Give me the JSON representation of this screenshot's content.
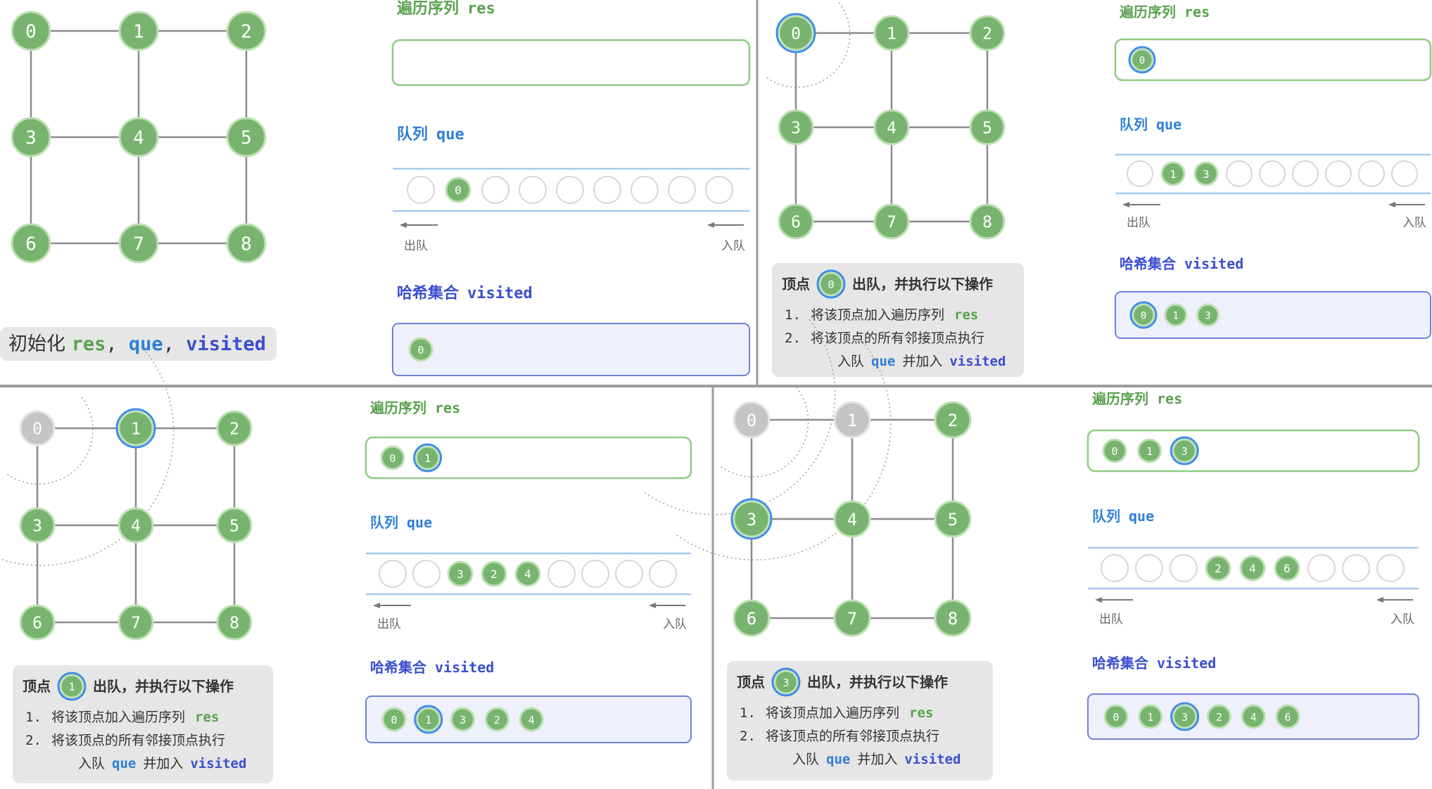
{
  "colors": {
    "node_fill": "#78b46f",
    "node_stroke": "#bfe0b6",
    "node_text": "#ffffff",
    "visited_fill": "#c5c5c5",
    "visited_stroke": "#e6e6e6",
    "current_ring": "#3f8ce8",
    "edge": "#8a8a8a",
    "title_green": "#5aa14f",
    "title_blue": "#2f7fd6",
    "title_indigo": "#3b4fcf",
    "res_border": "#8fcb83",
    "que_line": "#a8c8ee",
    "visited_box_bg": "#eef0fb",
    "visited_box_border": "#6f82d8",
    "caption_bg": "#e6e6e6",
    "empty_slot": "#d6d6d6"
  },
  "graph": {
    "nodes": [
      "0",
      "1",
      "2",
      "3",
      "4",
      "5",
      "6",
      "7",
      "8"
    ],
    "edges": [
      [
        0,
        1
      ],
      [
        1,
        2
      ],
      [
        0,
        3
      ],
      [
        1,
        4
      ],
      [
        2,
        5
      ],
      [
        3,
        4
      ],
      [
        4,
        5
      ],
      [
        3,
        6
      ],
      [
        4,
        7
      ],
      [
        5,
        8
      ],
      [
        6,
        7
      ],
      [
        7,
        8
      ]
    ]
  },
  "labels": {
    "res_title_cn": "遍历序列",
    "res_title_code": "res",
    "que_title_cn": "队列",
    "que_title_code": "que",
    "visited_title_cn": "哈希集合",
    "visited_title_code": "visited",
    "dequeue": "出队",
    "enqueue": "入队"
  },
  "panels": [
    {
      "id": "init",
      "caption_init": {
        "prefix": "初始化 ",
        "res": "res",
        "sep1": ", ",
        "que": "que",
        "sep2": ", ",
        "visited": "visited"
      },
      "gray_nodes": [],
      "current_node": null,
      "res": [],
      "queue": [
        "",
        "0",
        "",
        "",
        "",
        "",
        "",
        "",
        ""
      ],
      "visited": [
        "0"
      ]
    },
    {
      "id": "step1",
      "caption_step": {
        "prefix": "顶点",
        "vertex": "0",
        "suffix": "出队，并执行以下操作",
        "line1_num": "1.",
        "line1_text": "将该顶点加入遍历序列",
        "line1_code": "res",
        "line2_num": "2.",
        "line2_text": "将该顶点的所有邻接顶点执行",
        "line3_a": "入队",
        "line3_que": "que",
        "line3_b": "并加入",
        "line3_visited": "visited"
      },
      "gray_nodes": [],
      "current_node": "0",
      "res": [
        "0"
      ],
      "queue": [
        "",
        "1",
        "3",
        "",
        "",
        "",
        "",
        "",
        ""
      ],
      "visited": [
        "0",
        "1",
        "3"
      ]
    },
    {
      "id": "step2",
      "caption_step": {
        "prefix": "顶点",
        "vertex": "1",
        "suffix": "出队，并执行以下操作",
        "line1_num": "1.",
        "line1_text": "将该顶点加入遍历序列",
        "line1_code": "res",
        "line2_num": "2.",
        "line2_text": "将该顶点的所有邻接顶点执行",
        "line3_a": "入队",
        "line3_que": "que",
        "line3_b": "并加入",
        "line3_visited": "visited"
      },
      "gray_nodes": [
        "0"
      ],
      "current_node": "1",
      "res": [
        "0",
        "1"
      ],
      "queue": [
        "",
        "",
        "3",
        "2",
        "4",
        "",
        "",
        "",
        ""
      ],
      "visited": [
        "0",
        "1",
        "3",
        "2",
        "4"
      ]
    },
    {
      "id": "step3",
      "caption_step": {
        "prefix": "顶点",
        "vertex": "3",
        "suffix": "出队，并执行以下操作",
        "line1_num": "1.",
        "line1_text": "将该顶点加入遍历序列",
        "line1_code": "res",
        "line2_num": "2.",
        "line2_text": "将该顶点的所有邻接顶点执行",
        "line3_a": "入队",
        "line3_que": "que",
        "line3_b": "并加入",
        "line3_visited": "visited"
      },
      "gray_nodes": [
        "0",
        "1"
      ],
      "current_node": "3",
      "res": [
        "0",
        "1",
        "3"
      ],
      "queue": [
        "",
        "",
        "",
        "2",
        "4",
        "6",
        "",
        "",
        ""
      ],
      "visited": [
        "0",
        "1",
        "3",
        "2",
        "4",
        "6"
      ]
    }
  ]
}
